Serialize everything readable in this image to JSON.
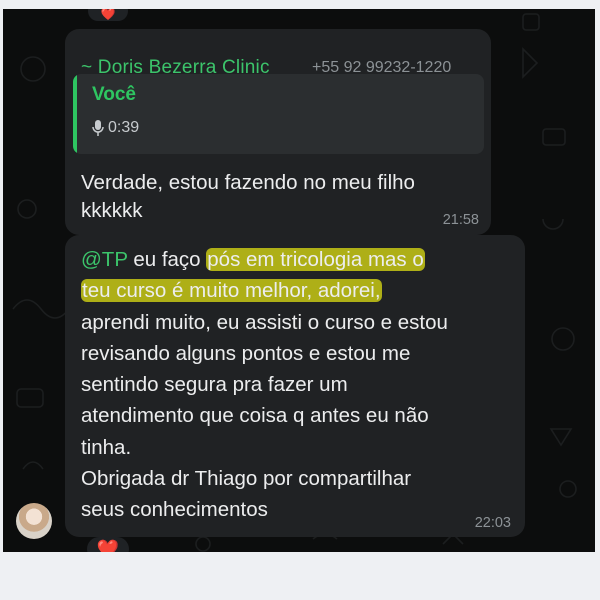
{
  "reactions": {
    "top": "❤️",
    "bottom": "❤️"
  },
  "message1": {
    "sender_name": "~ Doris Bezerra Clinic",
    "sender_phone": "+55 92 99232-1220",
    "quoted": {
      "author": "Você",
      "audio_duration": "0:39",
      "icon": "microphone-icon"
    },
    "text_line1": "Verdade, estou fazendo no meu filho",
    "text_line2": "kkkkkk",
    "time": "21:58"
  },
  "message2": {
    "mention": "@TP",
    "part1": " eu faço ",
    "highlight1": "pós em tricologia mas o",
    "highlight2": "teu curso é muito melhor, adorei,",
    "line3": "aprendi muito, eu assisti o curso e estou",
    "line4": "revisando alguns pontos e estou me",
    "line5": "sentindo segura pra fazer um",
    "line6": "atendimento que coisa q antes eu não",
    "line7": "tinha.",
    "line8": "Obrigada dr Thiago por compartilhar",
    "line9": "seus conhecimentos",
    "time": "22:03"
  },
  "colors": {
    "accent_green": "#3cc46b",
    "bubble": "#202224",
    "highlight": "#d6d713"
  }
}
